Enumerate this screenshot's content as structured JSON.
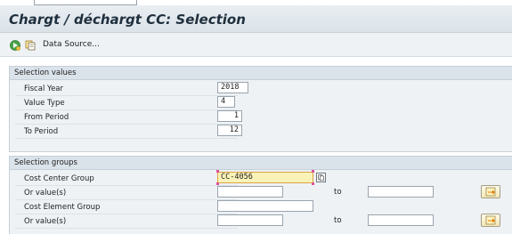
{
  "window": {
    "title": "Chargt / déchargt CC: Selection"
  },
  "toolbar": {
    "data_source_label": "Data Source..."
  },
  "selection_values": {
    "header": "Selection values",
    "fields": [
      {
        "label": "Fiscal Year",
        "value": "2018"
      },
      {
        "label": "Value Type",
        "value": "4"
      },
      {
        "label": "From Period",
        "value": "1"
      },
      {
        "label": "To Period",
        "value": "12"
      }
    ]
  },
  "selection_groups": {
    "header": "Selection groups",
    "to_label": "to",
    "rows": [
      {
        "label": "Cost Center Group",
        "value": "CC-4056"
      },
      {
        "label": "Or value(s)",
        "from": "",
        "to": ""
      },
      {
        "label": "Cost Element Group",
        "value": ""
      },
      {
        "label": "Or value(s)",
        "from": "",
        "to": ""
      }
    ]
  },
  "colors": {
    "title_bar": "#dbe3e9",
    "focused_field": "#fbf2b8",
    "group_header": "#dbe3ea"
  },
  "icons": [
    "execute-icon",
    "copy-icon",
    "multiple-selection-icon",
    "search-help-icon"
  ]
}
